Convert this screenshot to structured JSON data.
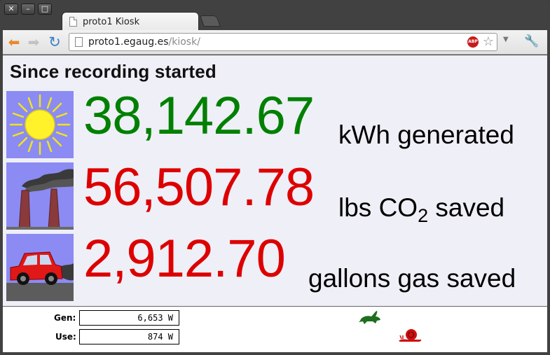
{
  "window": {
    "controls": [
      "✕",
      "–",
      "□"
    ]
  },
  "tab": {
    "title": "proto1 Kiosk"
  },
  "toolbar": {
    "url_host": "proto1.egaug.es",
    "url_path": "/kiosk/",
    "adblock_label": "ABP"
  },
  "kiosk": {
    "heading": "Since recording started",
    "rows": [
      {
        "value": "38,142.67",
        "unit": "kWh generated",
        "color": "#008000",
        "icon": "sun-icon"
      },
      {
        "value": "56,507.78",
        "unit_prefix": "lbs CO",
        "unit_sub": "2",
        "unit_suffix": " saved",
        "color": "#dd0000",
        "icon": "smokestack-icon"
      },
      {
        "value": "2,912.70",
        "unit": "gallons gas saved",
        "color": "#dd0000",
        "icon": "car-icon"
      }
    ]
  },
  "status": {
    "gen_label": "Gen:",
    "gen_value": "6,653 W",
    "use_label": "Use:",
    "use_value": "874 W",
    "rabbit_color": "#1e6e1e",
    "snail_color": "#cc1010"
  }
}
